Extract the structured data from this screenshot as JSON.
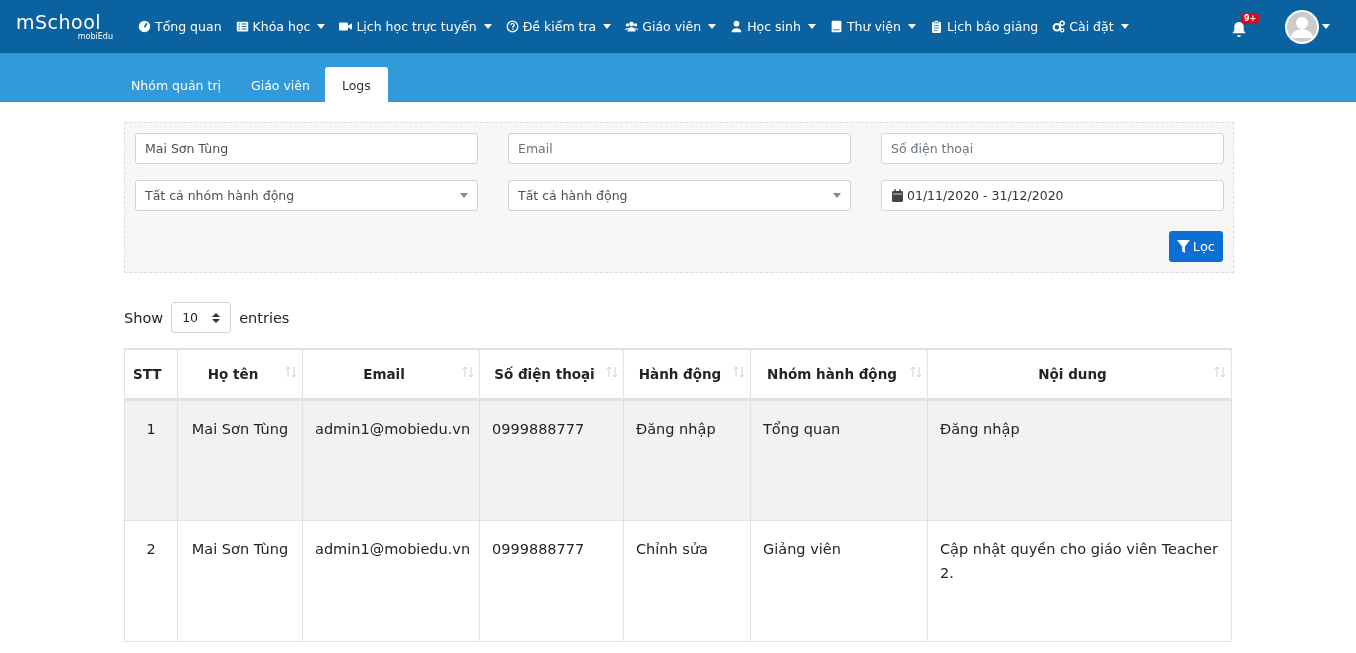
{
  "logo": {
    "title": "mSchool",
    "subtitle": "mobiEdu"
  },
  "nav": [
    {
      "label": "Tổng quan",
      "dropdown": false
    },
    {
      "label": "Khóa học",
      "dropdown": true
    },
    {
      "label": "Lịch học trực tuyến",
      "dropdown": true
    },
    {
      "label": "Đề kiểm tra",
      "dropdown": true
    },
    {
      "label": "Giáo viên",
      "dropdown": true
    },
    {
      "label": "Học sinh",
      "dropdown": true
    },
    {
      "label": "Thư viện",
      "dropdown": true
    },
    {
      "label": "Lịch báo giảng",
      "dropdown": false
    },
    {
      "label": "Cài đặt",
      "dropdown": true
    }
  ],
  "notifications": {
    "badge": "9+"
  },
  "tabs": [
    {
      "label": "Nhóm quản trị",
      "selected": false
    },
    {
      "label": "Giáo viên",
      "selected": false
    },
    {
      "label": "Logs",
      "selected": true
    }
  ],
  "filters": {
    "name": {
      "value": "Mai Sơn Tùng"
    },
    "email": {
      "placeholder": "Email"
    },
    "phone": {
      "placeholder": "Số điện thoại"
    },
    "action_group": "Tất cả nhóm hành động",
    "action": "Tất cả hành động",
    "date_range": "01/11/2020 - 31/12/2020",
    "filter_button": "Lọc"
  },
  "length": {
    "show": "Show",
    "value": "10",
    "entries": "entries"
  },
  "table": {
    "columns": [
      "STT",
      "Họ tên",
      "Email",
      "Số điện thoại",
      "Hành động",
      "Nhóm hành động",
      "Nội dung"
    ],
    "rows": [
      {
        "cells": [
          "1",
          "Mai Sơn Tùng",
          "admin1@mobiedu.vn",
          "0999888777",
          "Đăng nhập",
          "Tổng quan",
          "Đăng nhập"
        ],
        "selected": true
      },
      {
        "cells": [
          "2",
          "Mai Sơn Tùng",
          "admin1@mobiedu.vn",
          "0999888777",
          "Chỉnh sửa",
          "Giảng viên",
          "Cập nhật quyền cho giáo viên Teacher 2."
        ],
        "selected": false
      }
    ]
  }
}
